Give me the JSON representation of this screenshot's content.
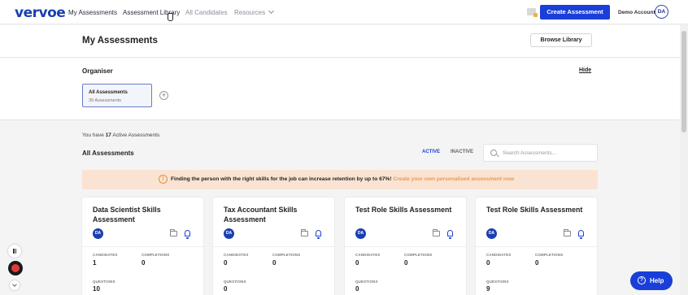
{
  "topbar": {
    "logo": "vervoe",
    "nav": [
      {
        "label": "My Assessments"
      },
      {
        "label": "Assessment Library"
      },
      {
        "label": "All Candidates"
      },
      {
        "label": "Resources"
      }
    ],
    "create_label": "Create Assessment",
    "account_label": "Demo Account",
    "avatar_initials": "DA"
  },
  "header": {
    "title": "My Assessments",
    "browse_label": "Browse Library"
  },
  "organiser": {
    "title": "Organiser",
    "hide_label": "Hide",
    "folder_title": "All Assessments",
    "folder_count": "39 Assessments"
  },
  "assessments": {
    "count_prefix": "You have ",
    "count_value": "17",
    "count_suffix": " Active Assessments",
    "section_title": "All Assessments",
    "tab_active": "ACTIVE",
    "tab_inactive": "INACTIVE",
    "search_placeholder": "Search Assessments..."
  },
  "banner": {
    "icon": "!",
    "text": "Finding the person with the right skills for the job can increase retention by up to 67%!",
    "link": "Create your own personalised assessment now"
  },
  "stat_labels": {
    "candidates": "CANDIDATES",
    "completions": "COMPLETIONS",
    "questions": "QUESTIONS"
  },
  "cards": [
    {
      "title": "Data Scientist Skills Assessment",
      "avatar": "DA",
      "candidates": "1",
      "completions": "0",
      "questions": "10"
    },
    {
      "title": "Tax Accountant Skills Assessment",
      "avatar": "DA",
      "candidates": "0",
      "completions": "0",
      "questions": "0"
    },
    {
      "title": "Test Role Skills Assessment",
      "avatar": "DA",
      "candidates": "0",
      "completions": "0",
      "questions": "0"
    },
    {
      "title": "Test Role Skills Assessment",
      "avatar": "DA",
      "candidates": "0",
      "completions": "0",
      "questions": "9"
    }
  ],
  "help": {
    "label": "Help",
    "icon": "?"
  },
  "colors": {
    "brand_blue": "#1a3fd8",
    "banner_bg": "#fbe3d3",
    "banner_link": "#e99a4a",
    "record_red": "#e23a3a"
  }
}
